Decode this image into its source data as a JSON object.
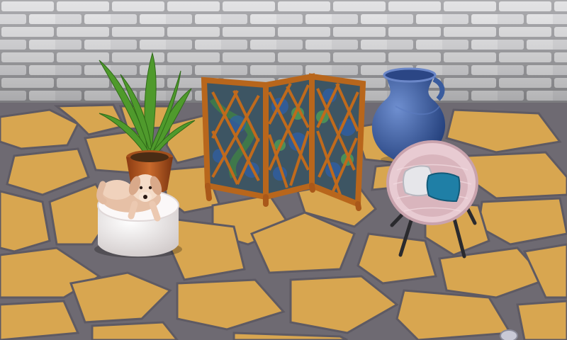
{
  "scene": {
    "objects": [
      {
        "id": "wall",
        "kind": "brick-wall",
        "color": "#d9d9db"
      },
      {
        "id": "floor",
        "kind": "flagstone-floor",
        "stone_color": "#d8a650",
        "grout_color": "#6e6a72"
      },
      {
        "id": "plant",
        "kind": "potted-plant",
        "pot_color": "#b4581e",
        "leaf_color": "#4f9a2c"
      },
      {
        "id": "screen",
        "kind": "folding-screen",
        "frame_color": "#c06a1c",
        "ivy_color": "#3f7f46"
      },
      {
        "id": "vase",
        "kind": "blue-vase",
        "color": "#3f63a8"
      },
      {
        "id": "chair",
        "kind": "wicker-chair",
        "color": "#e8cbd2",
        "pillow_colors": [
          "#e6e6ea",
          "#1f7fa6"
        ]
      },
      {
        "id": "pouf",
        "kind": "white-pouf",
        "color": "#f2eeee"
      },
      {
        "id": "puppy",
        "kind": "puppy",
        "color": "#f0d2bc"
      }
    ]
  }
}
